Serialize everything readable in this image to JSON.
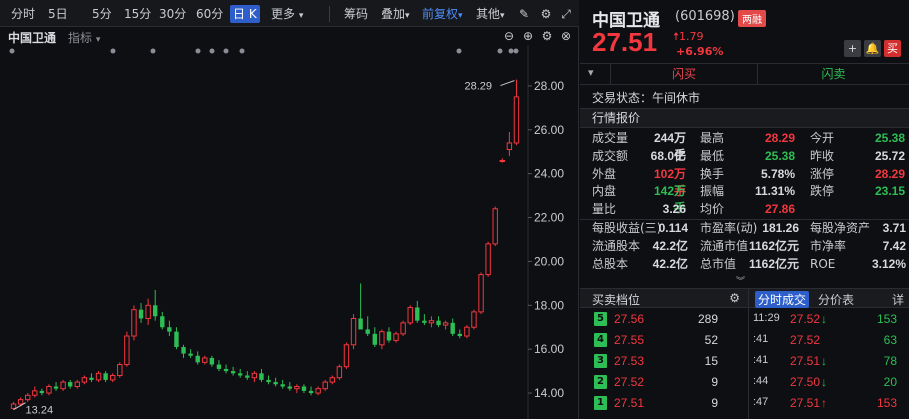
{
  "toolbar": {
    "periods": [
      "分时",
      "5日",
      "5分",
      "15分",
      "30分",
      "60分",
      "日 K",
      "更多"
    ],
    "active_period": "日 K",
    "tools": [
      "筹码",
      "叠加",
      "前复权",
      "其他"
    ]
  },
  "subbar": {
    "stock_name": "中国卫通",
    "indicator_label": "指标"
  },
  "chart_data": {
    "type": "candlestick",
    "title": "",
    "y_ticks": [
      "28.00",
      "26.00",
      "24.00",
      "22.00",
      "20.00",
      "18.00",
      "16.00",
      "14.00"
    ],
    "ylim": [
      13.0,
      29.5
    ],
    "max_label": "28.29",
    "min_label": "13.24",
    "colors": {
      "up": "#f2373f",
      "down": "#2dbe55",
      "grid": "#1e2024",
      "text": "#c9cbd0"
    },
    "candles": [
      {
        "o": 13.3,
        "h": 13.6,
        "l": 13.24,
        "c": 13.5
      },
      {
        "o": 13.5,
        "h": 13.8,
        "l": 13.4,
        "c": 13.7
      },
      {
        "o": 13.7,
        "h": 14.0,
        "l": 13.6,
        "c": 13.9
      },
      {
        "o": 13.9,
        "h": 14.3,
        "l": 13.8,
        "c": 14.1
      },
      {
        "o": 14.1,
        "h": 14.2,
        "l": 13.9,
        "c": 14.0
      },
      {
        "o": 14.0,
        "h": 14.4,
        "l": 13.9,
        "c": 14.3
      },
      {
        "o": 14.3,
        "h": 14.5,
        "l": 14.1,
        "c": 14.2
      },
      {
        "o": 14.2,
        "h": 14.6,
        "l": 14.1,
        "c": 14.5
      },
      {
        "o": 14.5,
        "h": 14.6,
        "l": 14.2,
        "c": 14.3
      },
      {
        "o": 14.3,
        "h": 14.6,
        "l": 14.2,
        "c": 14.5
      },
      {
        "o": 14.5,
        "h": 14.8,
        "l": 14.4,
        "c": 14.7
      },
      {
        "o": 14.7,
        "h": 14.9,
        "l": 14.5,
        "c": 14.6
      },
      {
        "o": 14.6,
        "h": 15.0,
        "l": 14.5,
        "c": 14.9
      },
      {
        "o": 14.9,
        "h": 15.0,
        "l": 14.5,
        "c": 14.6
      },
      {
        "o": 14.6,
        "h": 14.9,
        "l": 14.5,
        "c": 14.8
      },
      {
        "o": 14.8,
        "h": 15.4,
        "l": 14.7,
        "c": 15.3
      },
      {
        "o": 15.3,
        "h": 16.8,
        "l": 15.2,
        "c": 16.6
      },
      {
        "o": 16.6,
        "h": 18.0,
        "l": 16.4,
        "c": 17.8
      },
      {
        "o": 17.8,
        "h": 18.1,
        "l": 17.2,
        "c": 17.4
      },
      {
        "o": 17.4,
        "h": 18.3,
        "l": 17.1,
        "c": 18.0
      },
      {
        "o": 18.0,
        "h": 18.7,
        "l": 17.3,
        "c": 17.5
      },
      {
        "o": 17.5,
        "h": 17.7,
        "l": 16.9,
        "c": 17.0
      },
      {
        "o": 17.0,
        "h": 17.3,
        "l": 16.6,
        "c": 16.8
      },
      {
        "o": 16.8,
        "h": 17.0,
        "l": 16.0,
        "c": 16.1
      },
      {
        "o": 16.1,
        "h": 16.2,
        "l": 15.6,
        "c": 15.8
      },
      {
        "o": 15.8,
        "h": 16.0,
        "l": 15.6,
        "c": 15.7
      },
      {
        "o": 15.7,
        "h": 15.9,
        "l": 15.3,
        "c": 15.4
      },
      {
        "o": 15.4,
        "h": 15.7,
        "l": 15.3,
        "c": 15.6
      },
      {
        "o": 15.6,
        "h": 15.7,
        "l": 15.2,
        "c": 15.3
      },
      {
        "o": 15.3,
        "h": 15.5,
        "l": 15.0,
        "c": 15.1
      },
      {
        "o": 15.1,
        "h": 15.3,
        "l": 14.9,
        "c": 15.0
      },
      {
        "o": 15.0,
        "h": 15.2,
        "l": 14.8,
        "c": 14.9
      },
      {
        "o": 14.9,
        "h": 15.1,
        "l": 14.7,
        "c": 14.8
      },
      {
        "o": 14.8,
        "h": 15.0,
        "l": 14.6,
        "c": 14.7
      },
      {
        "o": 14.7,
        "h": 15.0,
        "l": 14.5,
        "c": 14.9
      },
      {
        "o": 14.9,
        "h": 15.1,
        "l": 14.5,
        "c": 14.6
      },
      {
        "o": 14.6,
        "h": 14.8,
        "l": 14.4,
        "c": 14.5
      },
      {
        "o": 14.5,
        "h": 14.7,
        "l": 14.3,
        "c": 14.4
      },
      {
        "o": 14.4,
        "h": 14.6,
        "l": 14.2,
        "c": 14.3
      },
      {
        "o": 14.3,
        "h": 14.5,
        "l": 14.1,
        "c": 14.2
      },
      {
        "o": 14.2,
        "h": 14.4,
        "l": 14.0,
        "c": 14.3
      },
      {
        "o": 14.3,
        "h": 14.4,
        "l": 14.0,
        "c": 14.1
      },
      {
        "o": 14.1,
        "h": 14.3,
        "l": 13.9,
        "c": 14.0
      },
      {
        "o": 14.0,
        "h": 14.3,
        "l": 13.9,
        "c": 14.2
      },
      {
        "o": 14.2,
        "h": 14.6,
        "l": 14.1,
        "c": 14.5
      },
      {
        "o": 14.5,
        "h": 14.8,
        "l": 14.4,
        "c": 14.7
      },
      {
        "o": 14.7,
        "h": 15.3,
        "l": 14.6,
        "c": 15.2
      },
      {
        "o": 15.2,
        "h": 16.3,
        "l": 15.1,
        "c": 16.2
      },
      {
        "o": 16.2,
        "h": 17.6,
        "l": 16.0,
        "c": 17.4
      },
      {
        "o": 17.4,
        "h": 19.0,
        "l": 16.9,
        "c": 16.9
      },
      {
        "o": 16.9,
        "h": 17.5,
        "l": 16.6,
        "c": 16.7
      },
      {
        "o": 16.7,
        "h": 17.0,
        "l": 16.1,
        "c": 16.2
      },
      {
        "o": 16.2,
        "h": 16.9,
        "l": 16.0,
        "c": 16.8
      },
      {
        "o": 16.8,
        "h": 17.0,
        "l": 16.3,
        "c": 16.4
      },
      {
        "o": 16.4,
        "h": 16.8,
        "l": 16.3,
        "c": 16.7
      },
      {
        "o": 16.7,
        "h": 17.3,
        "l": 16.6,
        "c": 17.2
      },
      {
        "o": 17.2,
        "h": 18.0,
        "l": 17.1,
        "c": 17.9
      },
      {
        "o": 17.9,
        "h": 18.2,
        "l": 17.2,
        "c": 17.3
      },
      {
        "o": 17.3,
        "h": 17.6,
        "l": 17.1,
        "c": 17.2
      },
      {
        "o": 17.2,
        "h": 17.5,
        "l": 17.0,
        "c": 17.3
      },
      {
        "o": 17.3,
        "h": 17.5,
        "l": 17.0,
        "c": 17.1
      },
      {
        "o": 17.1,
        "h": 17.3,
        "l": 16.9,
        "c": 17.2
      },
      {
        "o": 17.2,
        "h": 17.4,
        "l": 16.6,
        "c": 16.7
      },
      {
        "o": 16.7,
        "h": 16.9,
        "l": 16.5,
        "c": 16.6
      },
      {
        "o": 16.6,
        "h": 17.1,
        "l": 16.5,
        "c": 17.0
      },
      {
        "o": 17.0,
        "h": 17.8,
        "l": 16.9,
        "c": 17.7
      },
      {
        "o": 17.7,
        "h": 19.5,
        "l": 17.6,
        "c": 19.4
      },
      {
        "o": 19.4,
        "h": 20.9,
        "l": 19.3,
        "c": 20.8
      },
      {
        "o": 20.8,
        "h": 22.5,
        "l": 20.7,
        "c": 22.4
      },
      {
        "o": 24.6,
        "h": 24.7,
        "l": 24.5,
        "c": 24.6
      },
      {
        "o": 25.1,
        "h": 25.9,
        "l": 24.8,
        "c": 25.4
      },
      {
        "o": 25.4,
        "h": 28.29,
        "l": 25.3,
        "c": 27.5
      }
    ]
  },
  "quote": {
    "name": "中国卫通",
    "code": "(601698)",
    "badge": "两融",
    "price": "27.51",
    "change": "1.79",
    "pct": "+6.96%",
    "buttons": [
      "+",
      "bell",
      "买"
    ]
  },
  "flash": {
    "buy": "闪买",
    "sell": "闪卖"
  },
  "trade_status": "交易状态：午间休市",
  "section_title": "行情报价",
  "stats": [
    [
      {
        "label": "成交量",
        "value": "244万手",
        "color": "white"
      },
      {
        "label": "最高",
        "value": "28.29",
        "color": "red"
      },
      {
        "label": "今开",
        "value": "25.38",
        "color": "green"
      }
    ],
    [
      {
        "label": "成交额",
        "value": "68.0亿",
        "color": "white"
      },
      {
        "label": "最低",
        "value": "25.38",
        "color": "green"
      },
      {
        "label": "昨收",
        "value": "25.72",
        "color": "white"
      }
    ],
    [
      {
        "label": "外盘",
        "value": "102万手",
        "color": "red"
      },
      {
        "label": "换手",
        "value": "5.78%",
        "color": "white"
      },
      {
        "label": "涨停",
        "value": "28.29",
        "color": "red"
      }
    ],
    [
      {
        "label": "内盘",
        "value": "142万手",
        "color": "green"
      },
      {
        "label": "振幅",
        "value": "11.31%",
        "color": "white"
      },
      {
        "label": "跌停",
        "value": "23.15",
        "color": "green"
      }
    ],
    [
      {
        "label": "量比",
        "value": "3.26",
        "color": "white"
      },
      {
        "label": "均价",
        "value": "27.86",
        "color": "red"
      },
      {
        "label": "",
        "value": "",
        "color": "white"
      }
    ]
  ],
  "stats2": [
    [
      {
        "label": "每股收益(三)",
        "value": "0.114"
      },
      {
        "label": "市盈率(动)",
        "value": "181.26"
      },
      {
        "label": "每股净资产",
        "value": "3.71"
      }
    ],
    [
      {
        "label": "流通股本",
        "value": "42.2亿"
      },
      {
        "label": "流通市值",
        "value": "1162亿元"
      },
      {
        "label": "市净率",
        "value": "7.42"
      }
    ],
    [
      {
        "label": "总股本",
        "value": "42.2亿"
      },
      {
        "label": "总市值",
        "value": "1162亿元"
      },
      {
        "label": "ROE",
        "value": "3.12%"
      }
    ]
  ],
  "order_book": {
    "title": "买卖档位",
    "rows": [
      {
        "idx": "5",
        "price": "27.56",
        "vol": "289"
      },
      {
        "idx": "4",
        "price": "27.55",
        "vol": "52"
      },
      {
        "idx": "3",
        "price": "27.53",
        "vol": "15"
      },
      {
        "idx": "2",
        "price": "27.52",
        "vol": "9"
      },
      {
        "idx": "1",
        "price": "27.51",
        "vol": "9"
      }
    ]
  },
  "ticks": {
    "tabs": [
      "分时成交",
      "分价表",
      "详"
    ],
    "rows": [
      {
        "time": "11:29",
        "price": "27.52",
        "dir": "down",
        "vol": "153",
        "vol_color": "green"
      },
      {
        "time": ":41",
        "price": "27.52",
        "dir": "",
        "vol": "63",
        "vol_color": "green"
      },
      {
        "time": ":41",
        "price": "27.51",
        "dir": "down",
        "vol": "78",
        "vol_color": "green"
      },
      {
        "time": ":44",
        "price": "27.50",
        "dir": "down",
        "vol": "20",
        "vol_color": "green"
      },
      {
        "time": ":47",
        "price": "27.51",
        "dir": "up",
        "vol": "153",
        "vol_color": "red"
      }
    ]
  }
}
